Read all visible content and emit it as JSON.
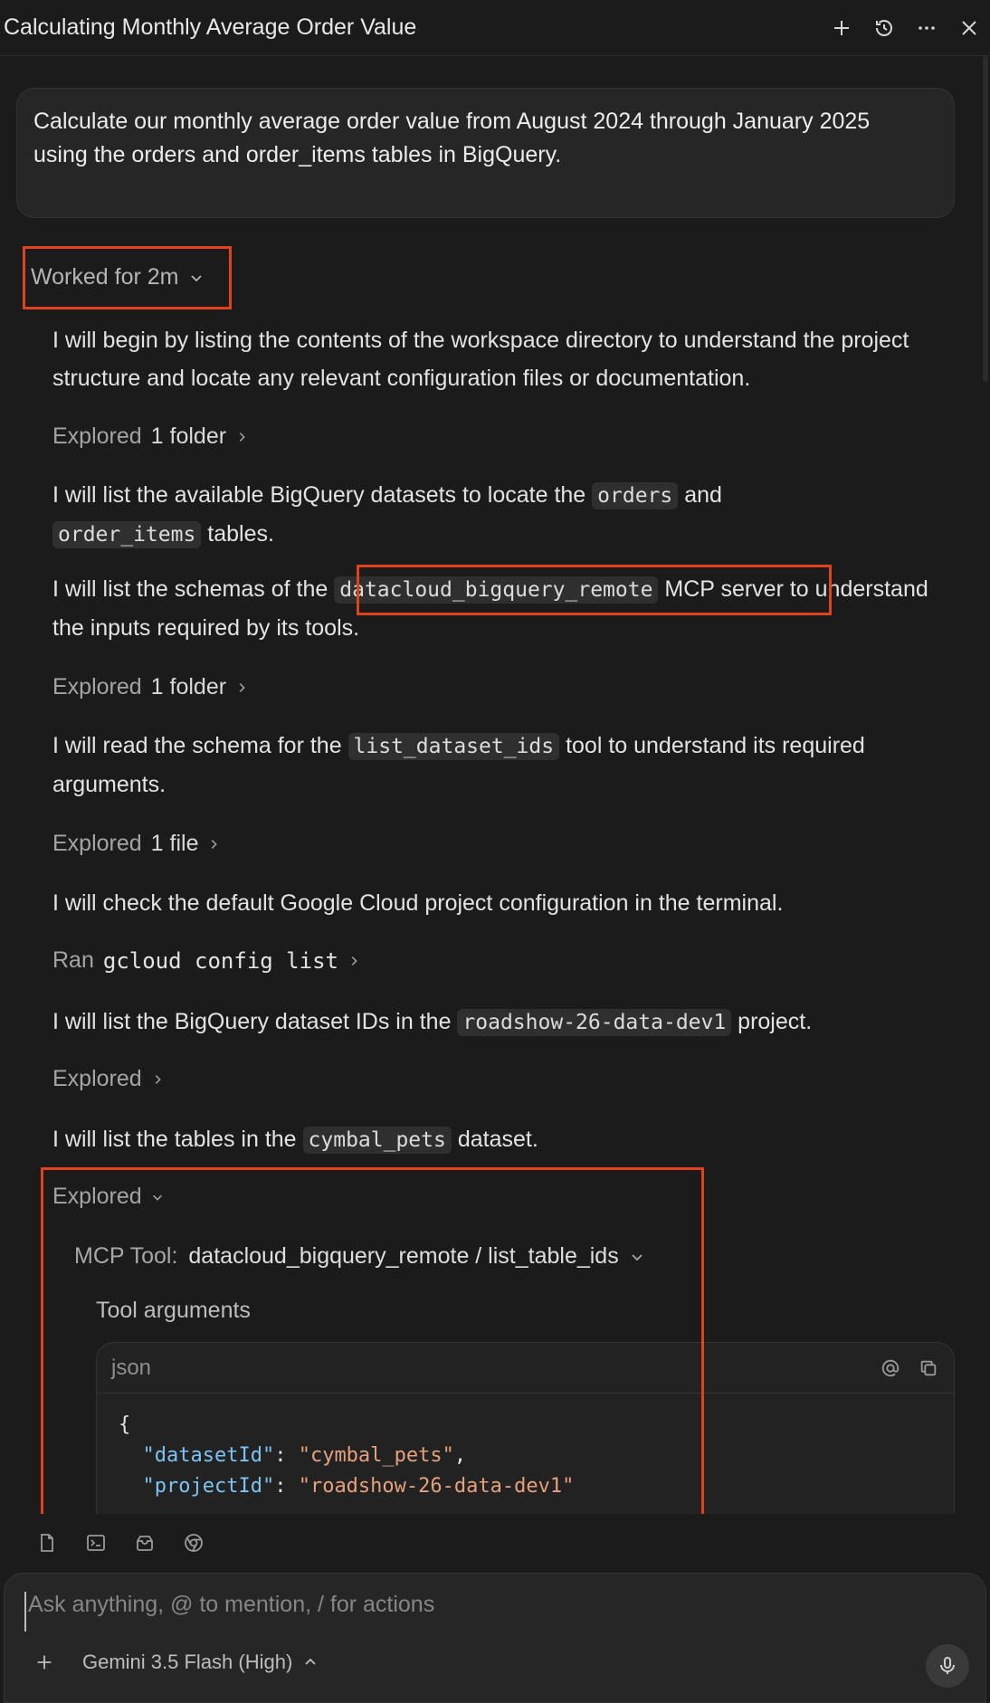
{
  "header": {
    "title": "Calculating Monthly Average Order Value"
  },
  "user_message": {
    "line1": "Calculate our monthly average order value from August 2024 through January 2025",
    "line2": "using the orders and order_items tables in BigQuery."
  },
  "worked": {
    "label": "Worked for 2m"
  },
  "steps": {
    "p1": "I will begin by listing the contents of the workspace directory to understand the project structure and locate any relevant configuration files or documentation.",
    "e1": {
      "verb": "Explored",
      "detail": "1 folder"
    },
    "p2_a": "I will list the available BigQuery datasets to locate the",
    "p2_code1": "orders",
    "p2_b": "and",
    "p2_code2": "order_items",
    "p2_c": "tables.",
    "p3_a": "I will list the schemas of the",
    "p3_code": "datacloud_bigquery_remote",
    "p3_b": "MCP server",
    "p3_c": "to understand the inputs required by its tools.",
    "e2": {
      "verb": "Explored",
      "detail": "1 folder"
    },
    "p4_a": "I will read the schema for the",
    "p4_code": "list_dataset_ids",
    "p4_b": "tool to understand its required arguments.",
    "e3": {
      "verb": "Explored",
      "detail": "1 file"
    },
    "p5": "I will check the default Google Cloud project configuration in the terminal.",
    "ran": {
      "verb": "Ran",
      "cmd": "gcloud config list"
    },
    "p6_a": "I will list the BigQuery dataset IDs in the",
    "p6_code": "roadshow-26-data-dev1",
    "p6_b": "project.",
    "e4": {
      "verb": "Explored"
    },
    "p7_a": "I will list the tables in the",
    "p7_code": "cymbal_pets",
    "p7_b": "dataset.",
    "e5": {
      "verb": "Explored"
    }
  },
  "mcp": {
    "prefix": "MCP Tool:",
    "name": "datacloud_bigquery_remote / list_table_ids",
    "args_label": "Tool arguments",
    "lang": "json",
    "open_brace": "{",
    "key1": "\"datasetId\"",
    "val1": "\"cymbal_pets\"",
    "key2": "\"projectId\"",
    "val2": "\"roadshow-26-data-dev1\""
  },
  "composer": {
    "placeholder": "Ask anything, @ to mention, / for actions",
    "model": "Gemini 3.5 Flash (High)"
  },
  "colors": {
    "background": "#1b1b1b",
    "highlight_box": "#e0421b",
    "json_key": "#7cc4f2",
    "json_string": "#e5a07c"
  }
}
